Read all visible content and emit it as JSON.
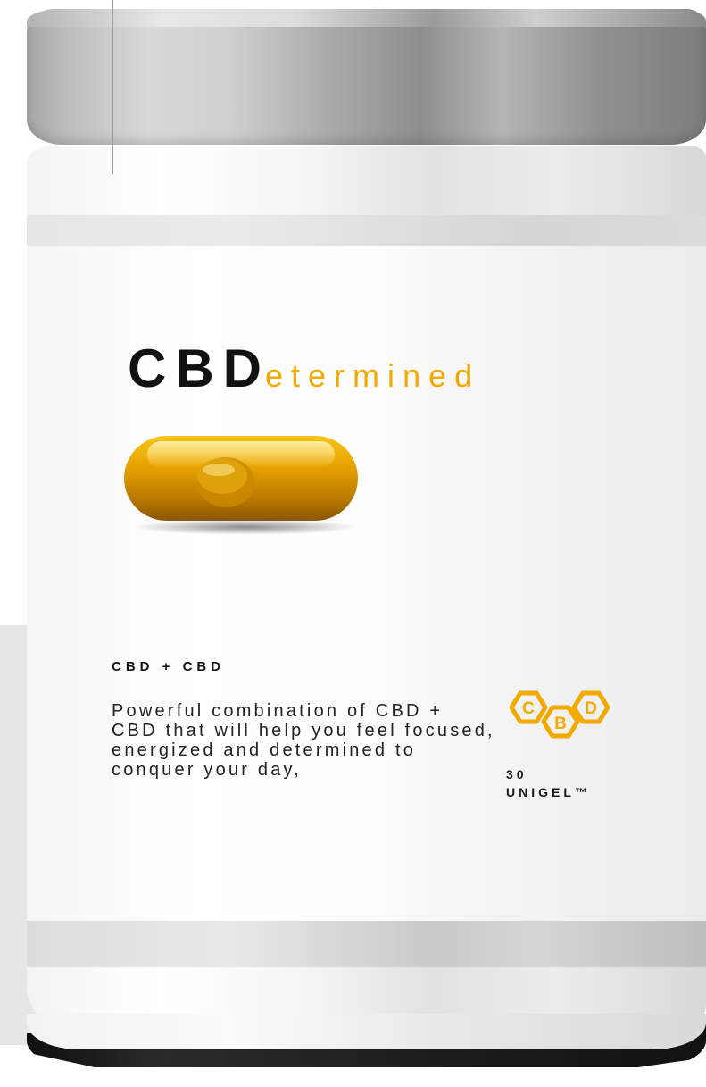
{
  "product": {
    "brand_prefix": "CBD",
    "brand_suffix": "etermined",
    "heading": "CBD + CBD",
    "description": "Powerful combination of CBD + CBD that will help you feel focused, energized and determined to conquer your day,",
    "count_number": "30",
    "count_unit": "UNIGEL™"
  },
  "logo": {
    "letters": [
      "C",
      "B",
      "D"
    ],
    "icon": "hexagon-cbd-logo"
  },
  "colors": {
    "accent": "#f2a900",
    "text_dark": "#111111",
    "capsule": "#e8a000"
  }
}
